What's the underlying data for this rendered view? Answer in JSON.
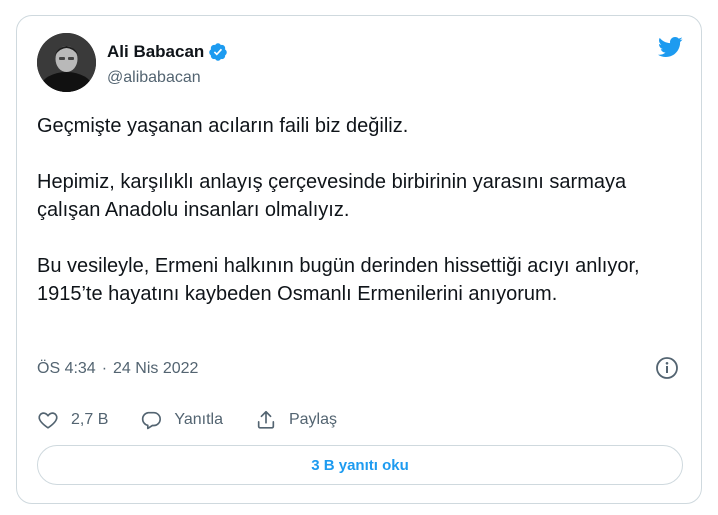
{
  "author": {
    "display_name": "Ali Babacan",
    "handle": "@alibabacan",
    "verified": true,
    "avatar": "avatar-photo"
  },
  "tweet": {
    "paragraphs": [
      "Geçmişte yaşanan acıların faili biz değiliz.",
      "Hepimiz, karşılıklı anlayış çerçevesinde birbirinin yarasını sarmaya çalışan Anadolu insanları olmalıyız.",
      "Bu vesileyle, Ermeni halkının bugün derinden hissettiği acıyı anlıyor, 1915’te hayatını kaybeden Osmanlı Ermenilerini anıyorum."
    ],
    "time": "ÖS 4:34",
    "separator": "·",
    "date": "24 Nis 2022"
  },
  "actions": {
    "like_count": "2,7 B",
    "reply_label": "Yanıtla",
    "share_label": "Paylaş"
  },
  "read_replies_label": "3 B yanıtı oku",
  "colors": {
    "accent": "#1d9bf0",
    "text": "#0f1419",
    "secondary": "#536471",
    "border": "#cfd9de"
  },
  "icons": {
    "brand": "twitter-bird-icon",
    "verified": "verified-badge-icon",
    "info": "info-icon",
    "like": "heart-icon",
    "reply": "reply-bubble-icon",
    "share": "share-icon"
  }
}
